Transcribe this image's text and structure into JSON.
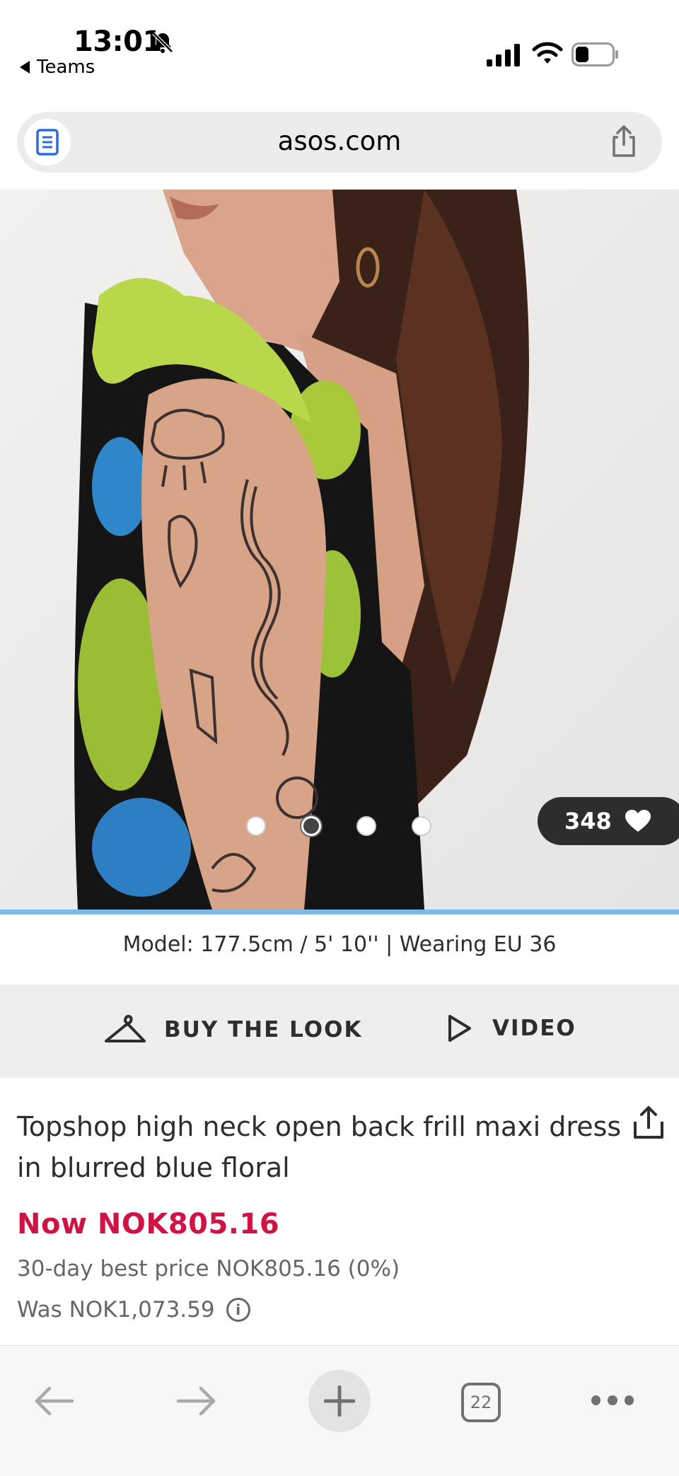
{
  "status_bar": {
    "time": "13:01",
    "back_app": "Teams"
  },
  "browser": {
    "url": "asos.com",
    "tab_count": "22"
  },
  "gallery": {
    "likes": "348",
    "dot_count": 4,
    "active_dot": 2
  },
  "model_info": "Model: 177.5cm / 5' 10'' | Wearing EU 36",
  "actions": {
    "buy_the_look": "BUY THE LOOK",
    "video": "VIDEO"
  },
  "product": {
    "title": "Topshop high neck open back frill maxi dress in blurred blue floral",
    "price_now": "Now NOK805.16",
    "best_price": "30-day best price NOK805.16 (0%)",
    "was_price": "Was NOK1,073.59",
    "info_glyph": "i"
  },
  "colors": {
    "sale_red": "#d01345",
    "progress_blue": "#7cb8e8",
    "dark": "#2d2d2d"
  }
}
